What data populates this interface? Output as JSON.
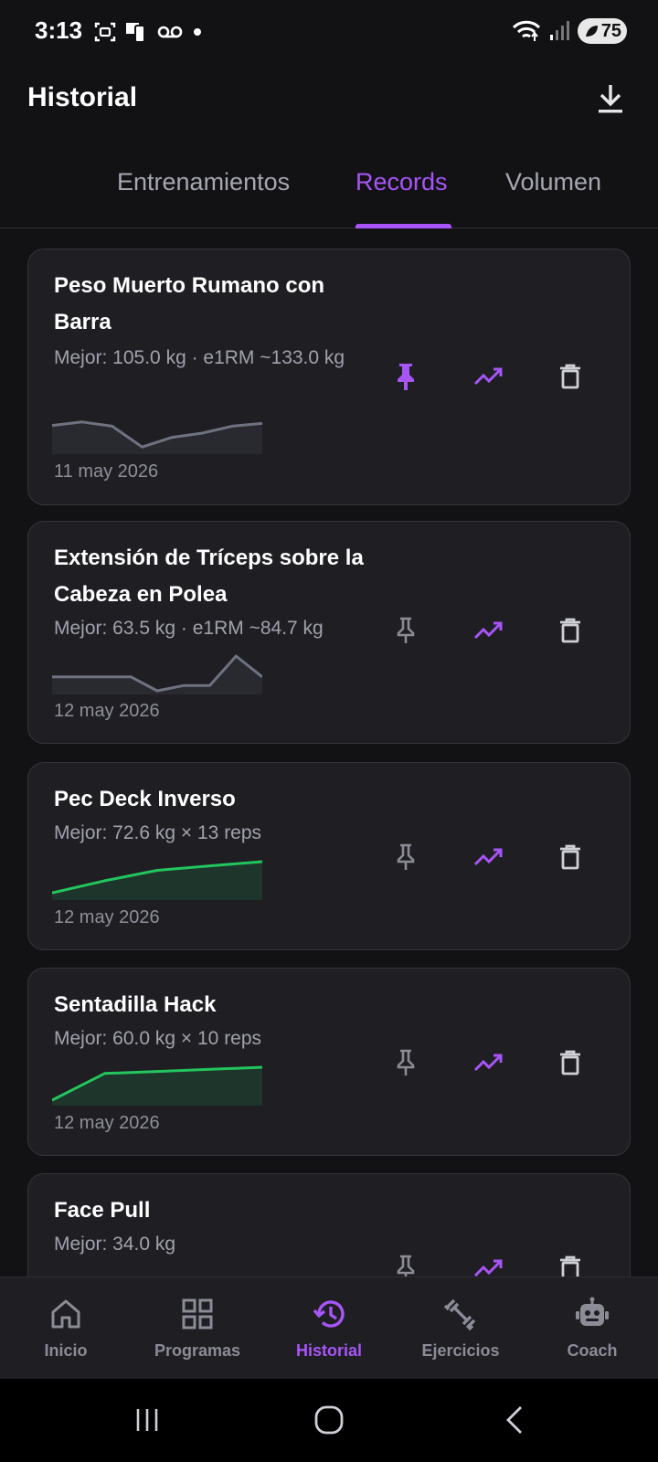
{
  "status": {
    "time": "3:13",
    "battery": "75"
  },
  "app_bar": {
    "title": "Historial"
  },
  "tabs": [
    {
      "label": "Entrenamientos",
      "active": false
    },
    {
      "label": "Records",
      "active": true
    },
    {
      "label": "Volumen",
      "active": false
    }
  ],
  "records": [
    {
      "title": "Peso Muerto Rumano con Barra",
      "best": "Mejor: 105.0 kg  ·  e1RM ~133.0 kg",
      "date": "11 may 2026",
      "pinned": true,
      "trend_color": "#6f7280",
      "trend": [
        0.72,
        0.82,
        0.7,
        0.1,
        0.38,
        0.5,
        0.7,
        0.78
      ]
    },
    {
      "title": "Extensión de Tríceps sobre la Cabeza en Polea",
      "best": "Mejor: 63.5 kg  ·  e1RM ~84.7 kg",
      "date": "12 may 2026",
      "pinned": false,
      "trend_color": "#6f7280",
      "trend": [
        0.4,
        0.4,
        0.4,
        0.4,
        0.0,
        0.15,
        0.15,
        1.0,
        0.4
      ]
    },
    {
      "title": "Pec Deck Inverso",
      "best": "Mejor: 72.6 kg × 13 reps",
      "date": "12 may 2026",
      "pinned": false,
      "trend_color": "#22c55e",
      "trend": [
        0.1,
        0.45,
        0.75,
        0.88,
        1.0
      ]
    },
    {
      "title": "Sentadilla Hack",
      "best": "Mejor: 60.0 kg × 10 reps",
      "date": "12 may 2026",
      "pinned": false,
      "trend_color": "#22c55e",
      "trend": [
        0.05,
        0.82,
        0.88,
        0.94,
        1.0
      ]
    },
    {
      "title": "Face Pull",
      "best": "Mejor: 34.0 kg",
      "date": "",
      "pinned": false,
      "trend_color": "#6f7280",
      "trend": []
    }
  ],
  "bottom_nav": [
    {
      "label": "Inicio",
      "icon": "home-icon",
      "active": false
    },
    {
      "label": "Programas",
      "icon": "grid-icon",
      "active": false
    },
    {
      "label": "Historial",
      "icon": "history-icon",
      "active": true
    },
    {
      "label": "Ejercicios",
      "icon": "dumbbell-icon",
      "active": false
    },
    {
      "label": "Coach",
      "icon": "robot-icon",
      "active": false
    }
  ],
  "colors": {
    "accent": "#a855f7",
    "green": "#22c55e",
    "muted": "#8b8c96",
    "card": "#1e1e23",
    "background": "#121215"
  }
}
